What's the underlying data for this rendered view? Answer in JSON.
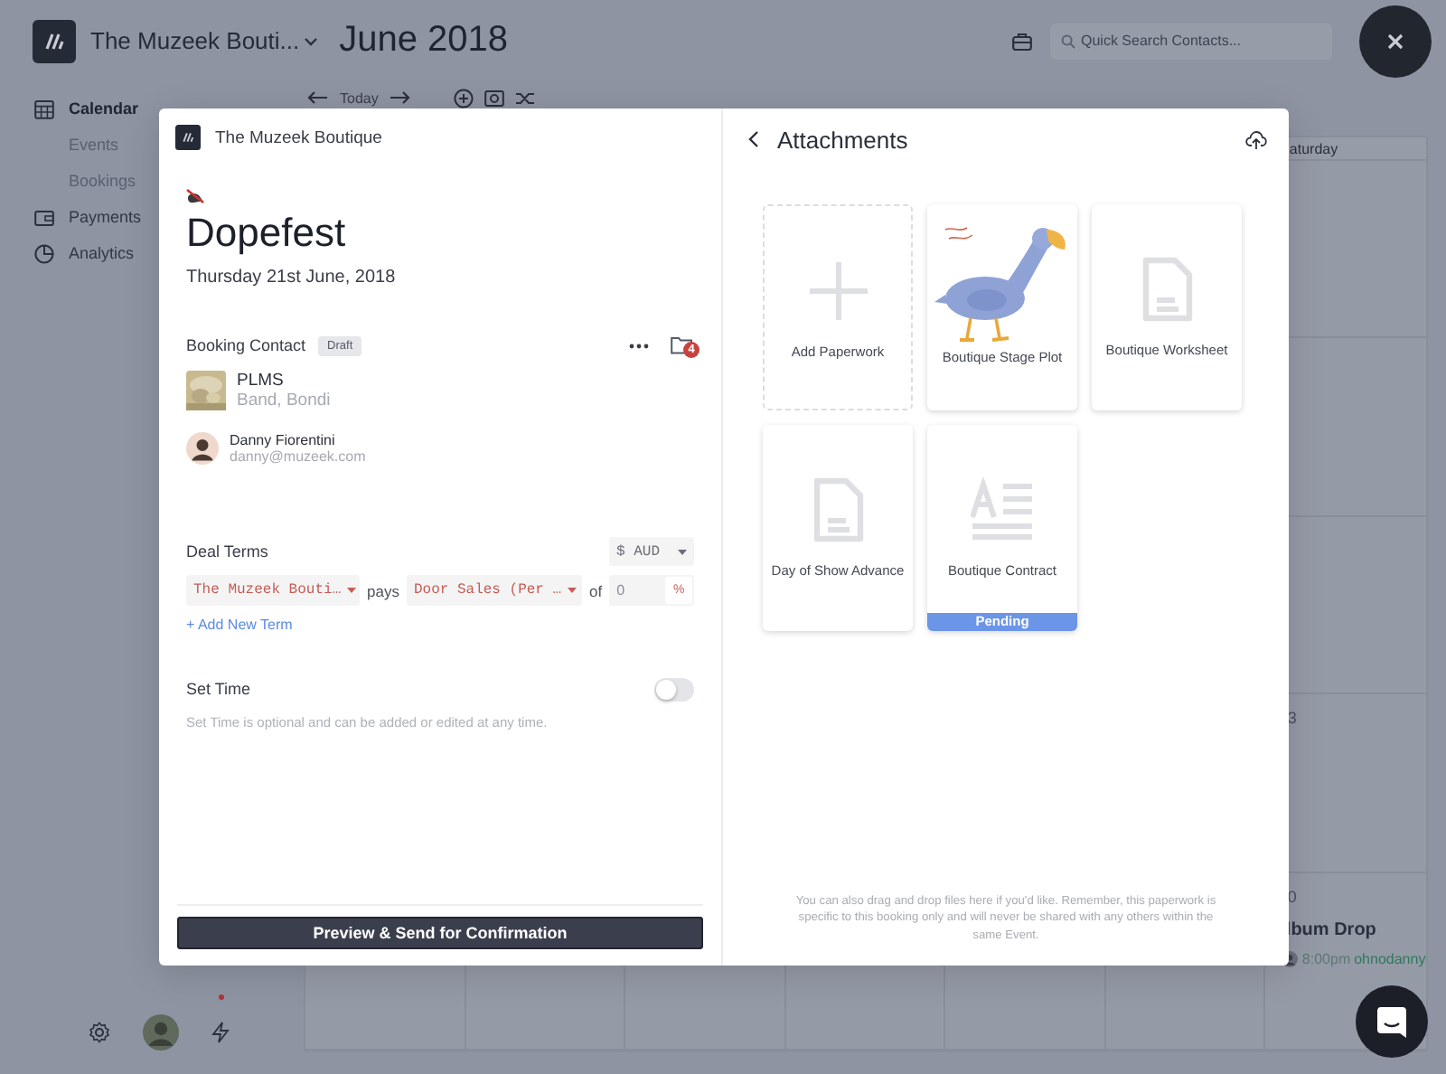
{
  "app": {
    "org_name": "The Muzeek Bouti...",
    "title": "June 2018",
    "search": {
      "placeholder": "Quick Search Contacts..."
    },
    "nav": [
      {
        "label": "Calendar",
        "selected": true,
        "children": [
          {
            "label": "Events",
            "selected": false
          },
          {
            "label": "Bookings",
            "selected": false
          }
        ]
      },
      {
        "label": "Payments",
        "selected": false
      },
      {
        "label": "Analytics",
        "selected": false
      }
    ],
    "toolbar": {
      "today": "Today"
    },
    "has_alerts": true,
    "calendar": {
      "weekday": "aturday",
      "cells": [
        {
          "date": "3"
        },
        {
          "date": "0",
          "events": [
            {
              "title": "lbum Drop",
              "time": "8:00pm",
              "owner": "ohnodanny"
            }
          ]
        }
      ]
    }
  },
  "booking": {
    "org": "The Muzeek Boutique",
    "title": "Dopefest",
    "date": "Thursday 21st June, 2018",
    "contact_heading": "Booking Contact",
    "status": "Draft",
    "attachment_count": "4",
    "contacts": [
      {
        "kind": "act",
        "name": "PLMS",
        "detail": "Band, Bondi"
      },
      {
        "kind": "person",
        "name": "Danny Fiorentini",
        "detail": "danny@muzeek.com"
      }
    ],
    "deal_terms": {
      "heading": "Deal Terms",
      "currency": "$ AUD",
      "terms": [
        {
          "payer": "The Muzeek Bouti…",
          "verb": "pays",
          "source": "Door Sales (Per …",
          "preposition": "of",
          "amount": "0",
          "unit": "%"
        }
      ],
      "add_link": "+ Add New Term"
    },
    "set_time": {
      "label": "Set Time",
      "on": false,
      "hint": "Set Time is optional and can be added or edited at any time."
    },
    "primary_button": "Preview & Send for Confirmation"
  },
  "attachments": {
    "title": "Attachments",
    "items": [
      {
        "kind": "add",
        "label": "Add Paperwork"
      },
      {
        "kind": "picture",
        "label": "Boutique Stage Plot"
      },
      {
        "kind": "document",
        "label": "Boutique Worksheet"
      },
      {
        "kind": "document",
        "label": "Day of Show Advance"
      },
      {
        "kind": "contract",
        "label": "Boutique Contract",
        "status": "Pending"
      }
    ],
    "note": "You can also drag and drop files here if you'd like. Remember, this paperwork is specific to this booking only and will never be shared with any others within the same Event."
  }
}
